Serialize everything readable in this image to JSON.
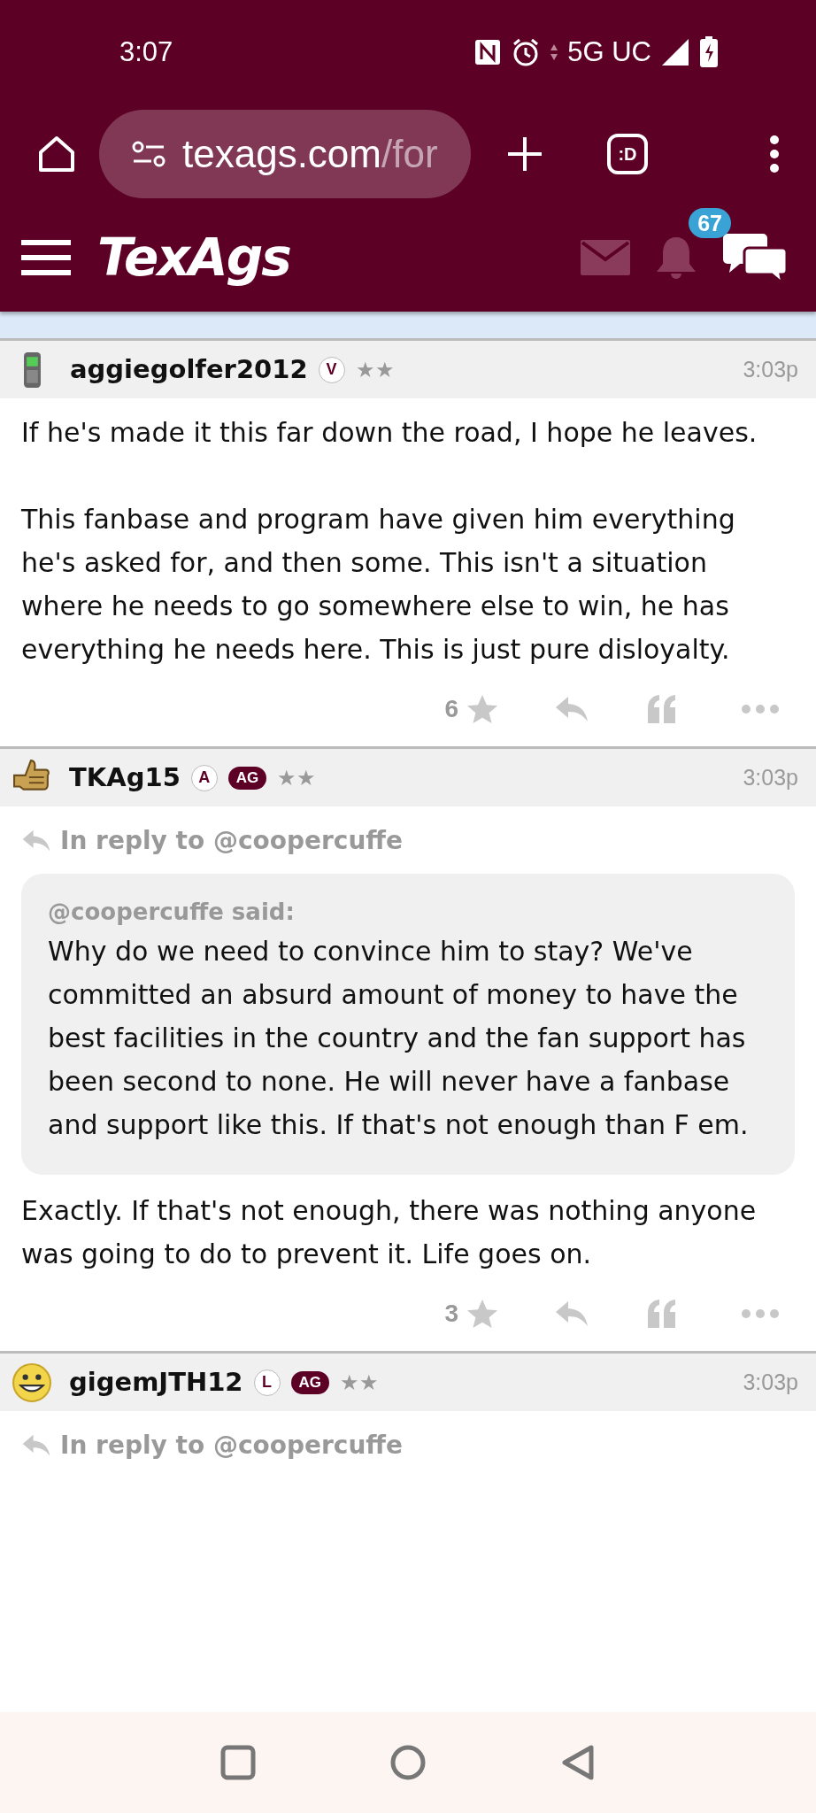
{
  "status_bar": {
    "time": "3:07",
    "network": "5G UC"
  },
  "browser": {
    "url_host": "texags.com",
    "url_path": "/for",
    "tabs_label": ":D"
  },
  "site_header": {
    "logo": "TexAgs",
    "notification_count": "67"
  },
  "posts": [
    {
      "username": "aggiegolfer2012",
      "badges": [
        {
          "label": "V",
          "kind": "circle"
        }
      ],
      "rank": "★★",
      "time": "3:03p",
      "paragraphs": [
        "If he's made it this far down the road, I hope he leaves.",
        "This fanbase and program have given him everything he's asked for, and then some. This isn't a situation where he needs to go somewhere else to win, he has everything he needs here. This is just pure disloyalty."
      ],
      "likes": "6"
    },
    {
      "username": "TKAg15",
      "badges": [
        {
          "label": "A",
          "kind": "circle"
        },
        {
          "label": "AG",
          "kind": "pill"
        }
      ],
      "rank": "★★",
      "time": "3:03p",
      "reply_to": "In reply to @coopercuffe",
      "quote": {
        "author": "@coopercuffe said:",
        "text": "Why do we need to convince him to stay? We've committed an absurd amount of money to have the best facilities in the country and the fan support has been second to none. He will never have a fanbase and support like this. If that's not enough than F em."
      },
      "paragraphs": [
        "Exactly. If that's not enough, there was nothing anyone was going to do to prevent it. Life goes on."
      ],
      "likes": "3"
    },
    {
      "username": "gigemJTH12",
      "badges": [
        {
          "label": "L",
          "kind": "circle"
        },
        {
          "label": "AG",
          "kind": "pill"
        }
      ],
      "rank": "★★",
      "time": "3:03p",
      "reply_to": "In reply to @coopercuffe"
    }
  ]
}
